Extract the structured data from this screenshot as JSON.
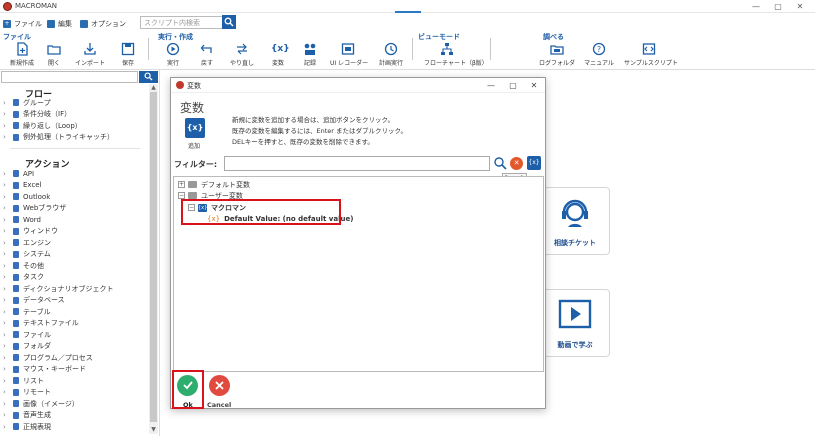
{
  "app": {
    "title": "MACROMAN"
  },
  "window_controls": {
    "minimize": "—",
    "maximize": "▢",
    "close": "✕"
  },
  "menu": {
    "file": "ファイル",
    "edit": "編集",
    "options": "オプション",
    "search_placeholder": "スクリプト内検索"
  },
  "ribbon": {
    "groups": {
      "file": "ファイル",
      "run": "実行・作成",
      "view": "ビューモード",
      "learn": "調べる"
    },
    "buttons": {
      "new": "新規作成",
      "open": "開く",
      "import": "インポート",
      "save": "保存",
      "run": "実行",
      "back": "戻す",
      "redo": "やり直し",
      "variable": "変数",
      "record": "記録",
      "ui_recorder": "UI レコーダー",
      "plan_run": "計画実行",
      "flowchart": "フローチャート（β版）",
      "log_folder": "ログフォルダ",
      "manual": "マニュアル",
      "sample": "サンプルスクリプト"
    }
  },
  "sidebar": {
    "flow_title": "フロー",
    "flow_items": [
      "グループ",
      "条件分岐（IF）",
      "繰り返し（Loop）",
      "例外処理（トライキャッチ）"
    ],
    "action_title": "アクション",
    "action_items": [
      "API",
      "Excel",
      "Outlook",
      "Webブラウザ",
      "Word",
      "ウィンドウ",
      "エンジン",
      "システム",
      "その他",
      "タスク",
      "ディクショナリオブジェクト",
      "データベース",
      "テーブル",
      "テキストファイル",
      "ファイル",
      "フォルダ",
      "プログラム／プロセス",
      "マウス・キーボード",
      "リスト",
      "リモート",
      "画像（イメージ）",
      "音声生成",
      "正規表現"
    ]
  },
  "tiles": {
    "support": "相談チケット",
    "video": "動画で学ぶ"
  },
  "dialog": {
    "title": "変数",
    "heading": "変数",
    "add_label": "追加",
    "add_icon": "{x}",
    "description": [
      "新規に変数を追加する場合は、追加ボタンをクリック。",
      "既存の変数を編集するには、Enter またはダブルクリック。",
      "DELキーを押すと、既存の変数を削除できます。"
    ],
    "filter_label": "フィルター:",
    "filter_value": "",
    "tooltip": "Search",
    "tree": {
      "default_vars": "デフォルト変数",
      "user_vars": "ユーザー変数",
      "var_name": "マクロマン",
      "var_default": "Default Value: (no default value)"
    },
    "ok": "Ok",
    "cancel": "Cancel"
  }
}
